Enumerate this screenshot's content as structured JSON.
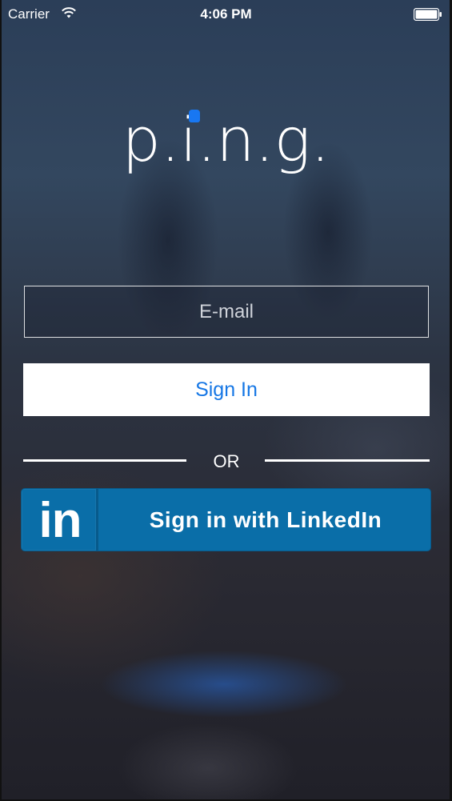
{
  "status_bar": {
    "carrier": "Carrier",
    "time": "4:06 PM"
  },
  "logo": {
    "text": "p.i.n.g.",
    "accent_color": "#1877f2"
  },
  "email_field": {
    "placeholder": "E-mail",
    "value": ""
  },
  "sign_in_button": {
    "label": "Sign In",
    "text_color": "#1677e5"
  },
  "divider": {
    "label": "OR"
  },
  "linkedin_button": {
    "icon_text": "in",
    "label": "Sign in with LinkedIn",
    "brand_color": "#0a6ea8"
  }
}
